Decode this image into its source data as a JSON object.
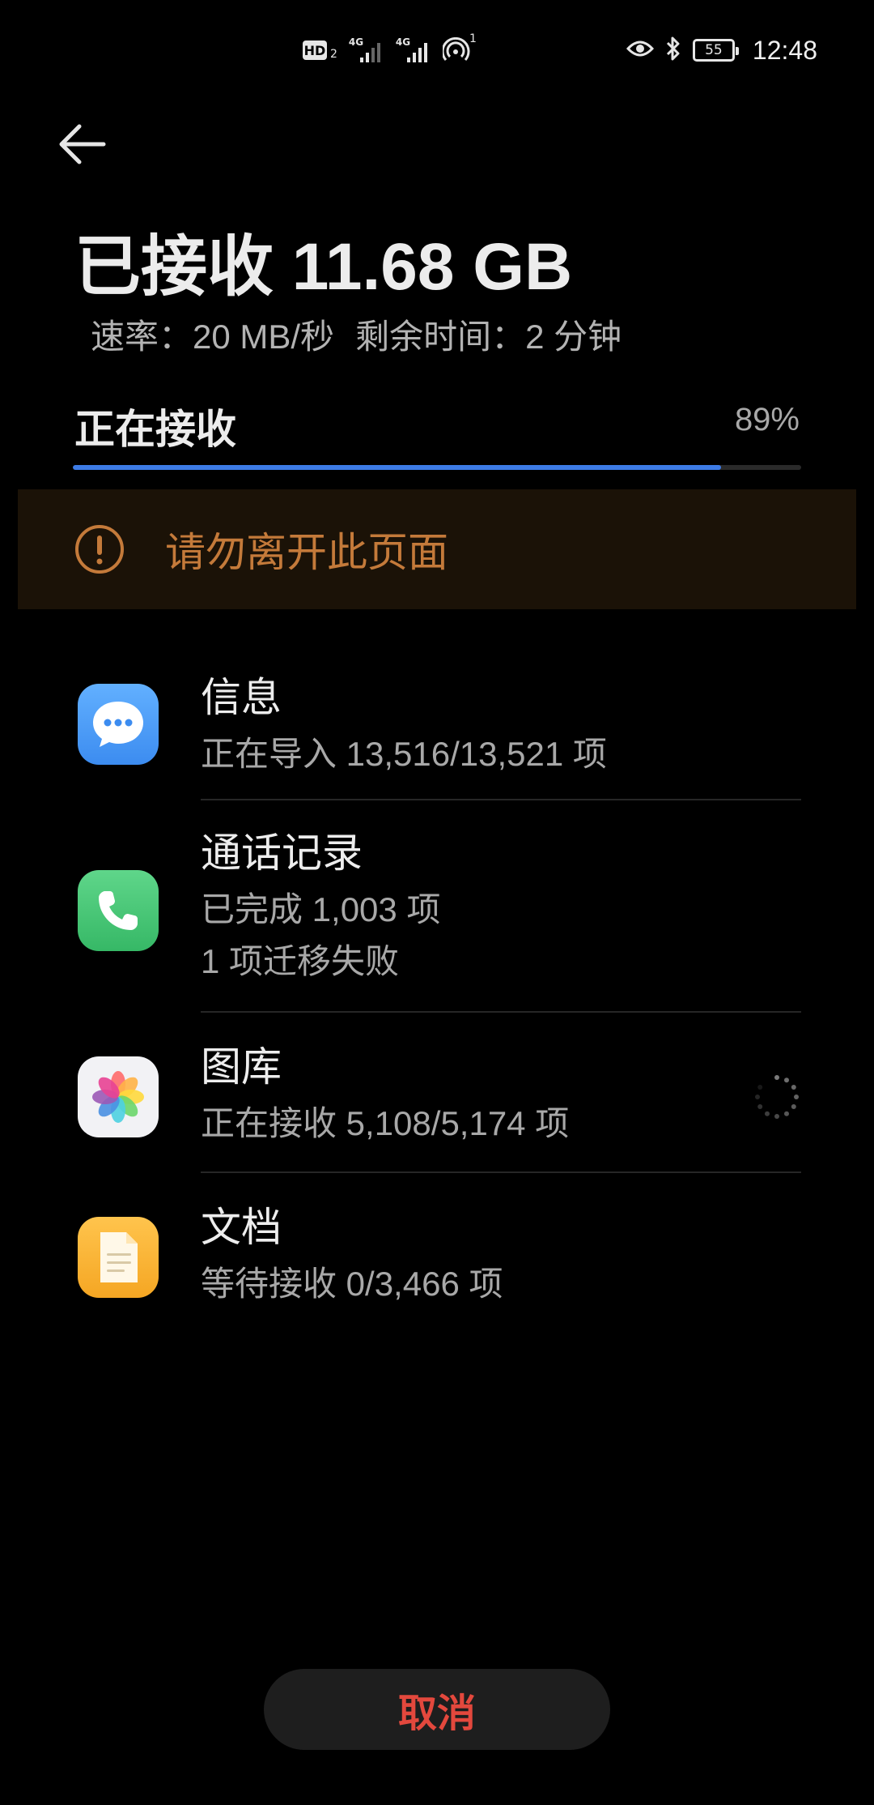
{
  "status_bar": {
    "network_tag_1": "4G",
    "network_tag_2": "4G",
    "hd_label": "HD",
    "hd_sub": "2",
    "hotspot_count": "1",
    "battery_level": "55",
    "time": "12:48",
    "icons": [
      "hd-icon",
      "signal-icon",
      "signal-icon",
      "hotspot-icon",
      "eye-icon",
      "bluetooth-icon",
      "battery-icon"
    ]
  },
  "header": {
    "back_icon": "back-arrow-icon",
    "received_title": "已接收 11.68 GB",
    "rate_text": "速率：20 MB/秒",
    "remaining_text": "剩余时间：2 分钟"
  },
  "progress": {
    "label": "正在接收",
    "percent_text": "89%",
    "value": 0.89,
    "fill_color": "#3d7be6"
  },
  "warning": {
    "icon": "exclamation-circle-icon",
    "text": "请勿离开此页面",
    "color": "#c47a3a"
  },
  "items": [
    {
      "icon": "messages-icon",
      "title": "信息",
      "status": "正在导入 13,516/13,521 项"
    },
    {
      "icon": "phone-icon",
      "title": "通话记录",
      "status": "已完成 1,003 项",
      "note": "1 项迁移失败"
    },
    {
      "icon": "gallery-icon",
      "title": "图库",
      "status": "正在接收 5,108/5,174 项",
      "indicator": "loading-spinner-icon"
    },
    {
      "icon": "documents-icon",
      "title": "文档",
      "status": "等待接收 0/3,466 项"
    }
  ],
  "cancel_button": {
    "label": "取消",
    "color": "#e3483d"
  }
}
